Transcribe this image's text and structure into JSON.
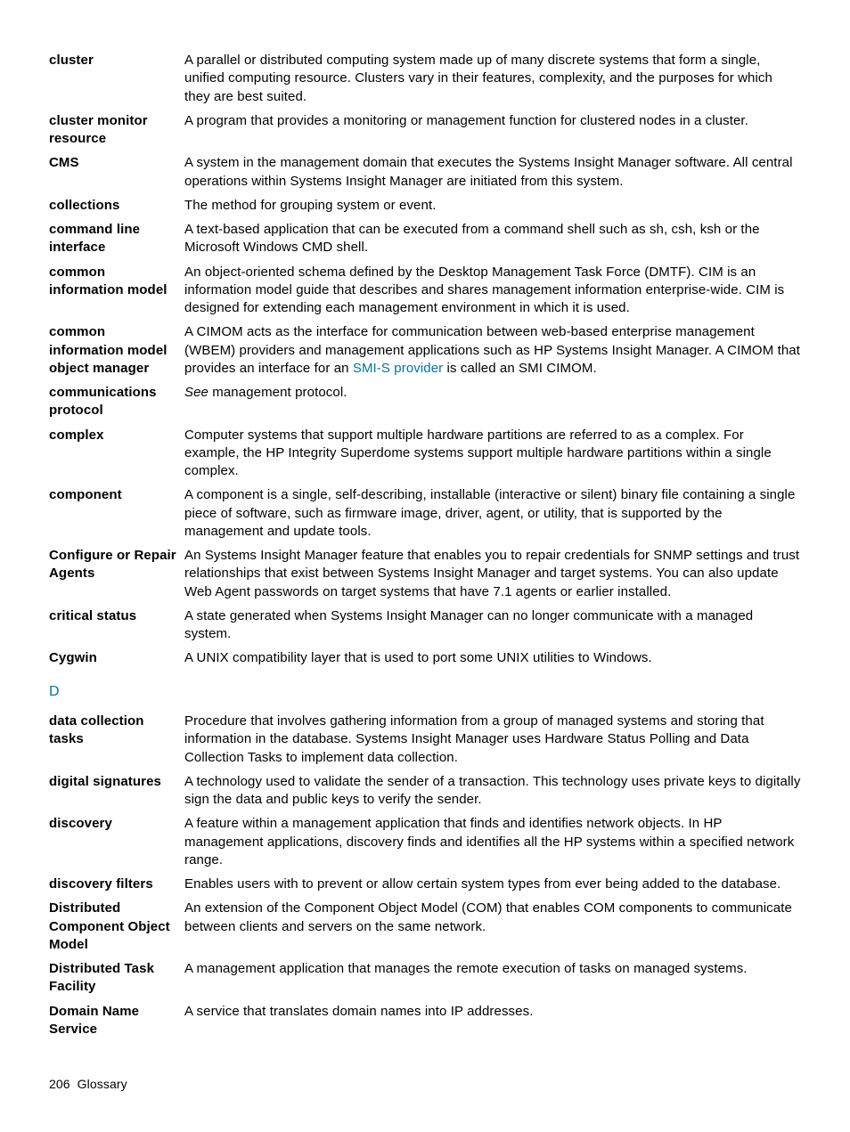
{
  "entries_c": [
    {
      "term": "cluster",
      "def": "A parallel or distributed computing system made up of many discrete systems that form a single, unified computing resource. Clusters vary in their features, complexity, and the purposes for which they are best suited."
    },
    {
      "term": "cluster monitor resource",
      "def": "A program that provides a monitoring or management function for clustered nodes in a cluster."
    },
    {
      "term": "CMS",
      "def": "A system in the management domain that executes the Systems Insight Manager software. All central operations within Systems Insight Manager are initiated from this system."
    },
    {
      "term": "collections",
      "def": "The method for grouping system or event."
    },
    {
      "term": "command line interface",
      "def": "A text-based application that can be executed from a command shell such as sh, csh, ksh or the Microsoft Windows CMD shell."
    },
    {
      "term": "common information model",
      "def": "An object-oriented schema defined by the Desktop Management Task Force (DMTF). CIM is an information model guide that describes and shares management information enterprise-wide. CIM is designed for extending each management environment in which it is used."
    },
    {
      "term": "common information model object manager",
      "def_pre": "A CIMOM acts as the interface for communication between web-based enterprise management (WBEM) providers and management applications such as HP Systems Insight Manager. A CIMOM that provides an interface for an ",
      "link": "SMI-S provider",
      "def_post": " is called an SMI CIMOM."
    },
    {
      "term": "communications protocol",
      "see": "See",
      "def_post": " management protocol."
    },
    {
      "term": "complex",
      "def": "Computer systems that support multiple hardware partitions are referred to as a complex. For example, the HP Integrity Superdome systems support multiple hardware partitions within a single complex."
    },
    {
      "term": "component",
      "def": "A component is a single, self-describing, installable (interactive or silent) binary file containing a single piece of software, such as firmware image, driver, agent, or utility, that is supported by the management and update tools."
    },
    {
      "term": "Configure or Repair Agents",
      "def": "An Systems Insight Manager feature that enables you to repair credentials for SNMP settings and trust relationships that exist between Systems Insight Manager and target systems. You can also update Web Agent passwords on target systems that have 7.1 agents or earlier installed."
    },
    {
      "term": "critical status",
      "def": "A state generated when Systems Insight Manager can no longer communicate with a managed system."
    },
    {
      "term": "Cygwin",
      "def": "A UNIX compatibility layer that is used to port some UNIX utilities to Windows."
    }
  ],
  "section_d": "D",
  "entries_d": [
    {
      "term": "data collection tasks",
      "def": "Procedure that involves gathering information from a group of managed systems and storing that information in the database. Systems Insight Manager uses Hardware Status Polling and Data Collection Tasks to implement data collection."
    },
    {
      "term": "digital signatures",
      "def": "A technology used to validate the sender of a transaction. This technology uses private keys to digitally sign the data and public keys to verify the sender."
    },
    {
      "term": "discovery",
      "def": "A feature within a management application that finds and identifies network objects. In HP management applications, discovery finds and identifies all the HP systems within a specified network range."
    },
    {
      "term": "discovery filters",
      "def": "Enables users with to prevent or allow certain system types from ever being added to the database."
    },
    {
      "term": "Distributed Component Object Model",
      "def": "An extension of the Component Object Model (COM) that enables COM components to communicate between clients and servers on the same network."
    },
    {
      "term": "Distributed Task Facility",
      "def": "A management application that manages the remote execution of tasks on managed systems."
    },
    {
      "term": "Domain Name Service",
      "def": "A service that translates domain names into IP addresses."
    }
  ],
  "footer": {
    "page": "206",
    "title": "Glossary"
  }
}
